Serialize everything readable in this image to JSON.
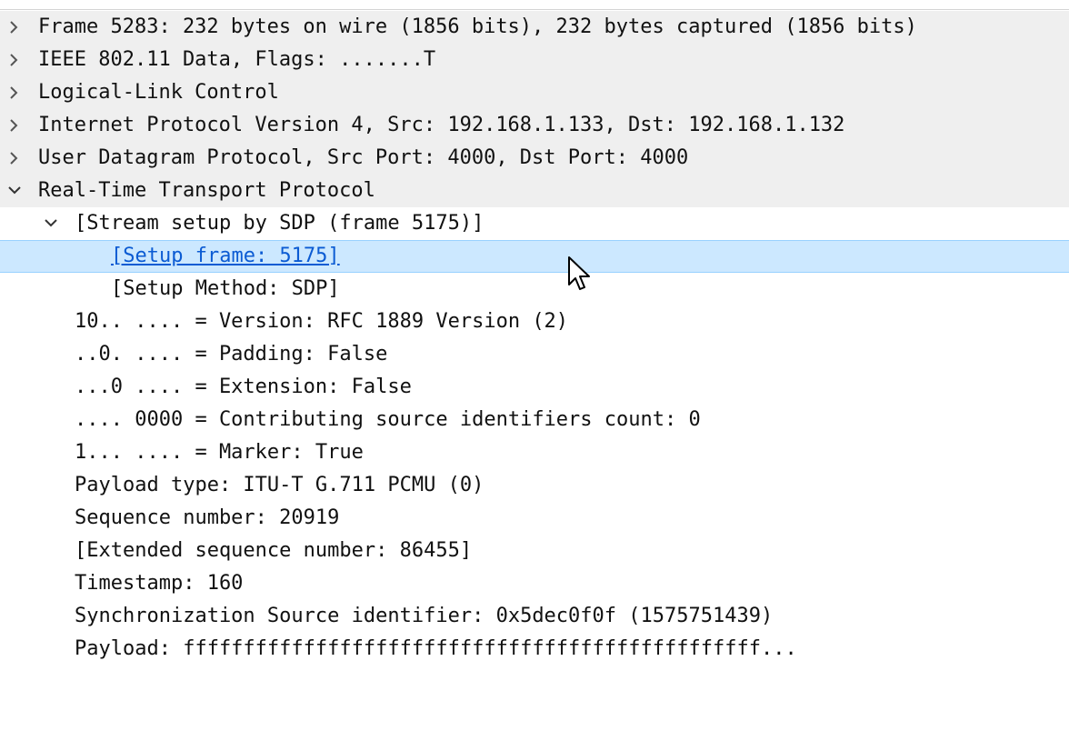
{
  "tree": {
    "frame_row": "Frame 5283: 232 bytes on wire (1856 bits), 232 bytes captured (1856 bits)",
    "ieee_row": "IEEE 802.11 Data, Flags: .......T",
    "llc_row": "Logical-Link Control",
    "ip_row": "Internet Protocol Version 4, Src: 192.168.1.133, Dst: 192.168.1.132",
    "udp_row": "User Datagram Protocol, Src Port: 4000, Dst Port: 4000",
    "rtp_row": "Real-Time Transport Protocol",
    "rtp": {
      "stream_setup": "[Stream setup by SDP (frame 5175)]",
      "setup_frame": "[Setup frame: 5175]",
      "setup_method": "[Setup Method: SDP]",
      "version": "10.. .... = Version: RFC 1889 Version (2)",
      "padding": "..0. .... = Padding: False",
      "extension": "...0 .... = Extension: False",
      "csrc_count": ".... 0000 = Contributing source identifiers count: 0",
      "marker": "1... .... = Marker: True",
      "payload_type": "Payload type: ITU-T G.711 PCMU (0)",
      "sequence": "Sequence number: 20919",
      "ext_sequence": "[Extended sequence number: 86455]",
      "timestamp": "Timestamp: 160",
      "ssrc": "Synchronization Source identifier: 0x5dec0f0f (1575751439)",
      "payload": "Payload: ffffffffffffffffffffffffffffffffffffffffffffffff..."
    }
  },
  "icons": {
    "collapsed": "chevron-right-icon",
    "expanded": "chevron-down-icon",
    "cursor": "mouse-pointer-icon"
  },
  "colors": {
    "row_bg": "#efefef",
    "selection_bg": "#cce8ff",
    "selection_border": "#99d1ff",
    "link": "#0b5bd3"
  }
}
